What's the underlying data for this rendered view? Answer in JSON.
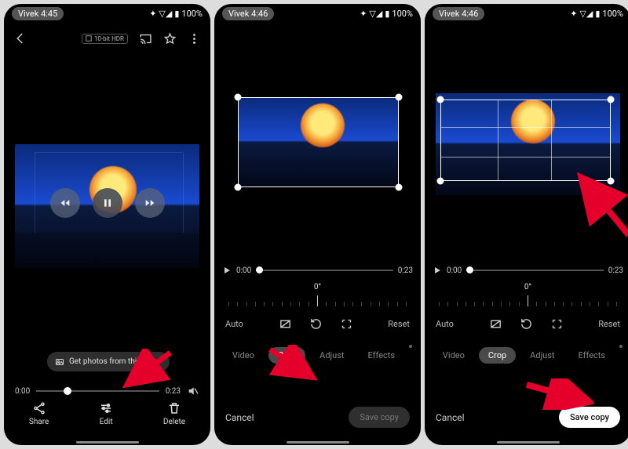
{
  "status": {
    "userTime1": "Vivek 4:45",
    "userTime2": "Vivek 4:46",
    "battery": "100%"
  },
  "topbar": {
    "hdr": "10-bit HDR"
  },
  "panel1": {
    "chip": "Get photos from this video",
    "time_start": "0:00",
    "time_end": "0:23",
    "share": "Share",
    "edit": "Edit",
    "delete": "Delete"
  },
  "crop": {
    "time_start": "0:00",
    "time_end": "0:23",
    "angle": "0°",
    "auto": "Auto",
    "reset": "Reset",
    "tab_video": "Video",
    "tab_crop": "Crop",
    "tab_adjust": "Adjust",
    "tab_effects": "Effects",
    "cancel": "Cancel",
    "save": "Save copy"
  }
}
